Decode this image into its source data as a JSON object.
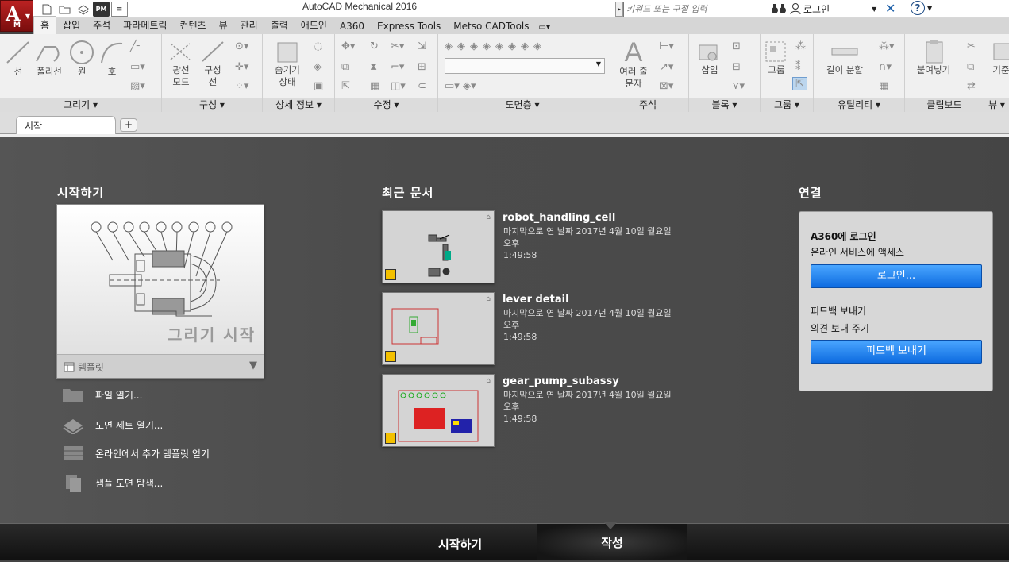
{
  "app": {
    "title": "AutoCAD Mechanical 2016",
    "button_letter": "A",
    "button_sub": "M",
    "qat_pm": "PM"
  },
  "search": {
    "placeholder": "키워드 또는 구절 입력"
  },
  "user": {
    "login": "로그인"
  },
  "help": {
    "symbol": "?"
  },
  "menu": {
    "tabs": [
      "홈",
      "삽입",
      "주석",
      "파라메트릭",
      "컨텐츠",
      "뷰",
      "관리",
      "출력",
      "애드인",
      "A360",
      "Express Tools",
      "Metso CADTools"
    ],
    "active": "홈"
  },
  "ribbon": {
    "draw": {
      "title": "그리기 ▾",
      "line": "선",
      "polyline": "폴리선",
      "circle": "원",
      "arc": "호"
    },
    "construct": {
      "title": "구성 ▾",
      "ray": "광선\n모드",
      "xline": "구성\n선"
    },
    "detail": {
      "title": "상세 정보 ▾",
      "hide": "숨기기\n상태"
    },
    "modify": {
      "title": "수정 ▾"
    },
    "layers": {
      "title": "도면층 ▾"
    },
    "annotation": {
      "title": "주석",
      "mtext": "여러 줄\n문자"
    },
    "block": {
      "title": "블록 ▾",
      "insert": "삽입"
    },
    "group": {
      "title": "그룹 ▾",
      "group": "그룹"
    },
    "utilities": {
      "title": "유틸리티 ▾",
      "measure": "길이 분할"
    },
    "clipboard": {
      "title": "클립보드",
      "paste": "붙여넣기"
    },
    "view": {
      "title": "뷰 ▾",
      "base": "기준"
    }
  },
  "tabs": {
    "start": "시작",
    "add": "+"
  },
  "start": {
    "section_templates": "시작하기",
    "template_label": "그리기 시작",
    "template_dropdown": "템플릿",
    "actions": [
      "파일 열기...",
      "도면 세트 열기...",
      "온라인에서 추가 템플릿 얻기",
      "샘플 도면 탐색..."
    ],
    "section_recent": "최근 문서",
    "recent": [
      {
        "name": "robot_handling_cell",
        "meta": "마지막으로 연 날짜 2017년 4월 10일 월요일 오후",
        "time": "1:49:58"
      },
      {
        "name": "lever detail",
        "meta": "마지막으로 연 날짜 2017년 4월 10일 월요일 오후",
        "time": "1:49:58"
      },
      {
        "name": "gear_pump_subassy",
        "meta": "마지막으로 연 날짜 2017년 4월 10일 월요일 오후",
        "time": "1:49:58"
      }
    ],
    "section_connect": "연결",
    "connect": {
      "a360": "A360에 로그인",
      "a360_sub": "온라인 서비스에 액세스",
      "login_btn": "로그인...",
      "feedback": "피드백 보내기",
      "feedback_sub": "의견 보내 주기",
      "feedback_btn": "피드백 보내기"
    }
  },
  "bottom": {
    "learn": "시작하기",
    "create": "작성"
  }
}
